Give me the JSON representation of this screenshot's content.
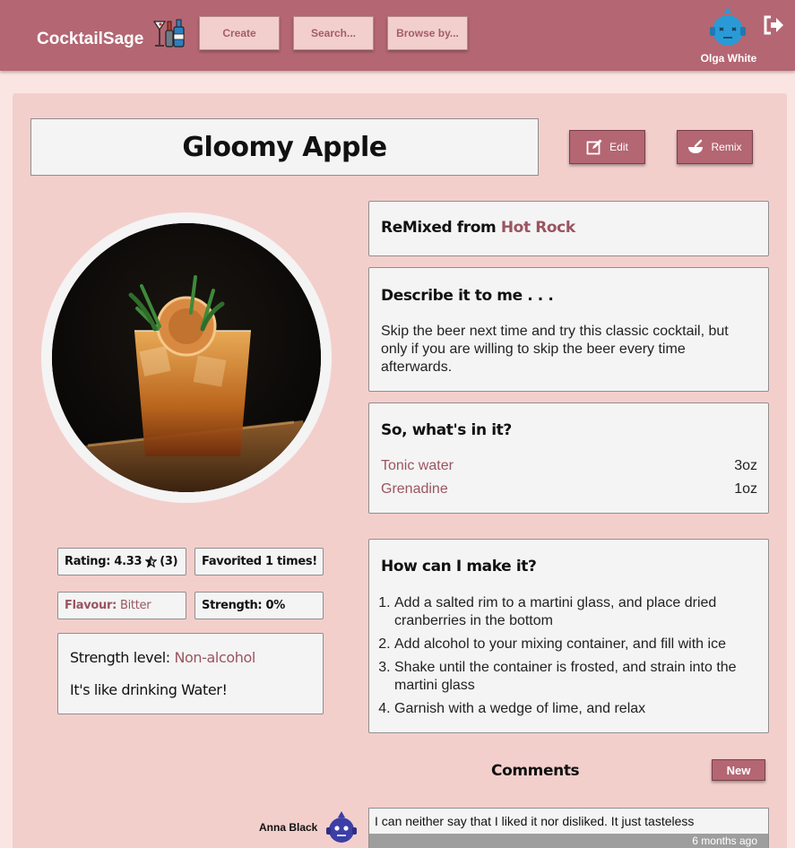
{
  "header": {
    "app_name": "CocktailSage",
    "nav": [
      {
        "label": "Create"
      },
      {
        "label": "Search..."
      },
      {
        "label": "Browse by..."
      }
    ],
    "user_name": "Olga White",
    "bar_color": "#b46673"
  },
  "recipe": {
    "title": "Gloomy Apple",
    "edit_label": "Edit",
    "remix_label": "Remix",
    "remixed_prefix": "ReMixed from",
    "remixed_source": "Hot Rock",
    "describe_title": "Describe it to me . . .",
    "description": "Skip the beer next time and try this classic cocktail, but only if you are willing to skip the beer every time afterwards.",
    "ingredients_title": "So, what's in it?",
    "ingredients": [
      {
        "name": "Tonic water",
        "amount": "3oz"
      },
      {
        "name": "Grenadine",
        "amount": "1oz"
      }
    ],
    "steps_title": "How can I make it?",
    "steps": [
      "Add a salted rim to a martini glass, and place dried cranberries in the bottom",
      "Add alcohol to your mixing container, and fill with ice",
      "Shake until the container is frosted, and strain into the martini glass",
      "Garnish with a wedge of lime, and relax"
    ]
  },
  "stats": {
    "rating_prefix": "Rating: 4.33",
    "rating_count": "(3)",
    "favorited": "Favorited 1 times!",
    "flavour_label": "Flavour:",
    "flavour_value": "Bitter",
    "strength": "Strength: 0%",
    "strength_level_label": "Strength level:",
    "strength_level_value": "Non-alcohol",
    "strength_comment": "It's like drinking Water!"
  },
  "comments": {
    "title": "Comments",
    "new_label": "New",
    "items": [
      {
        "author": "Anna Black",
        "text": "I can neither say that I liked it nor disliked. It just tasteless",
        "time": "6 months ago"
      }
    ]
  },
  "icons": {
    "logo": "cocktail-bottles-icon",
    "avatar": "robot-avatar-icon",
    "logout": "logout-icon",
    "edit": "edit-icon",
    "remix": "mortar-pestle-icon",
    "star": "star-half-icon"
  }
}
